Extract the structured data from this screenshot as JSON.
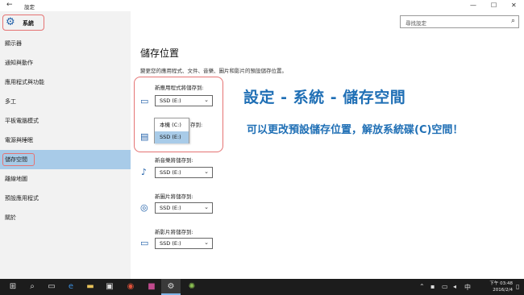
{
  "window": {
    "title": "設定",
    "back_glyph": "←",
    "min_glyph": "—",
    "max_glyph": "☐",
    "close_glyph": "✕"
  },
  "sidebar": {
    "header_label": "系統",
    "items": [
      {
        "label": "顯示器"
      },
      {
        "label": "通知與動作"
      },
      {
        "label": "應用程式與功能"
      },
      {
        "label": "多工"
      },
      {
        "label": "平板電腦模式"
      },
      {
        "label": "電源與睡眠"
      },
      {
        "label": "儲存空間"
      },
      {
        "label": "離線地圖"
      },
      {
        "label": "預設應用程式"
      },
      {
        "label": "關於"
      }
    ]
  },
  "search": {
    "placeholder": "尋找設定",
    "icon": "search-icon"
  },
  "main": {
    "title": "儲存位置",
    "subtitle": "變更您的應用程式、文件、音樂、圖片和影片的預設儲存位置。",
    "locations": [
      {
        "label": "新應用程式將儲存到:",
        "value": "SSD (E:)",
        "icon": "monitor-icon"
      },
      {
        "label": "新文件將儲存到:",
        "value": "SSD (E:)",
        "icon": "folder-icon"
      },
      {
        "label": "新音樂將儲存到:",
        "value": "SSD (E:)",
        "icon": "music-icon"
      },
      {
        "label": "新圖片將儲存到:",
        "value": "SSD (E:)",
        "icon": "camera-icon"
      },
      {
        "label": "新影片將儲存到:",
        "value": "SSD (E:)",
        "icon": "video-icon"
      }
    ],
    "doc_label_visible": "存到:",
    "dropdown_options": [
      {
        "label": "本機 (C:)"
      },
      {
        "label": "SSD (E:)"
      }
    ]
  },
  "annotation": {
    "headline": "設定 - 系統 - 儲存空間",
    "subline": "可以更改預設儲存位置，解放系統碟(C)空間！",
    "color": "#1f6fb5"
  },
  "taskbar": {
    "clock_time": "下午 03:48",
    "clock_date": "2016/2/4"
  }
}
